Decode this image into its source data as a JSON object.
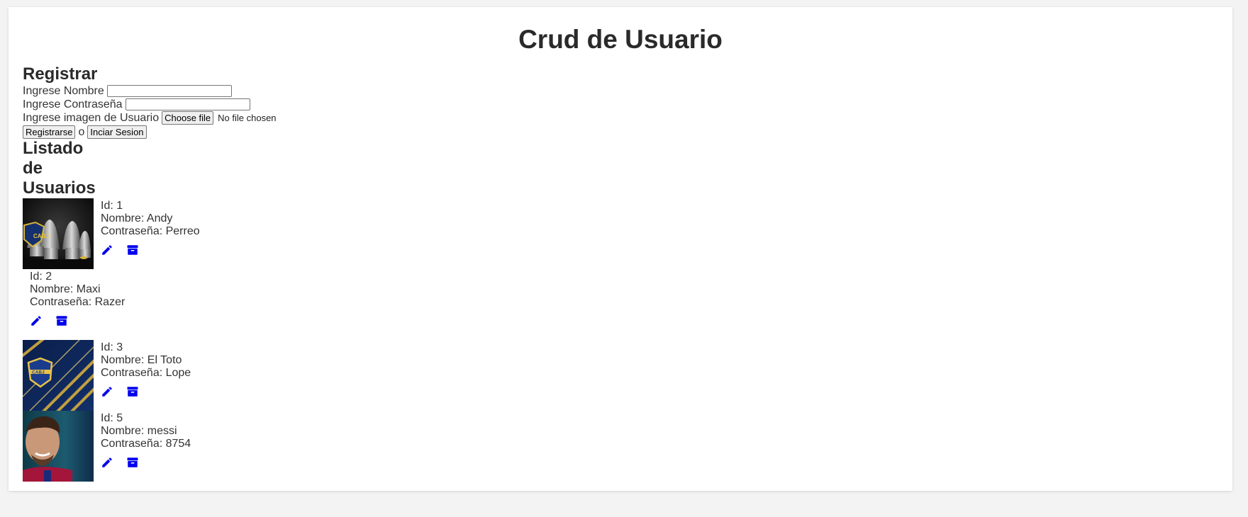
{
  "page": {
    "title": "Crud de Usuario"
  },
  "register": {
    "heading": "Registrar",
    "name_label": "Ingrese Nombre",
    "name_value": "",
    "password_label": "Ingrese Contraseña",
    "password_value": "",
    "image_label": "Ingrese imagen de Usuario",
    "file_button_label": "Choose file",
    "file_status": "No file chosen",
    "register_button": "Registrarse",
    "or_text": "o",
    "login_button": "Inciar Sesion"
  },
  "list": {
    "heading": "Listado de Usuarios",
    "users": [
      {
        "id": "Id: 1",
        "name": "Nombre: Andy",
        "password": "Contraseña: Perreo",
        "photo": "trophies-and-shield"
      },
      {
        "id": "Id: 2",
        "name": "Nombre: Maxi",
        "password": "Contraseña: Razer",
        "photo": "none"
      },
      {
        "id": "Id: 3",
        "name": "Nombre: El Toto",
        "password": "Contraseña: Lope",
        "photo": "cabj-shield-blue-yellow"
      },
      {
        "id": "Id: 5",
        "name": "Nombre: messi",
        "password": "Contraseña: 8754",
        "photo": "player-portrait"
      }
    ]
  },
  "icons": {
    "edit": "pencil-icon",
    "delete": "archive-icon"
  },
  "colors": {
    "icon": "#0000ee",
    "heading": "#2a2a2a",
    "text": "#333333",
    "page_background": "#f3f3f3",
    "card_background": "#ffffff"
  }
}
